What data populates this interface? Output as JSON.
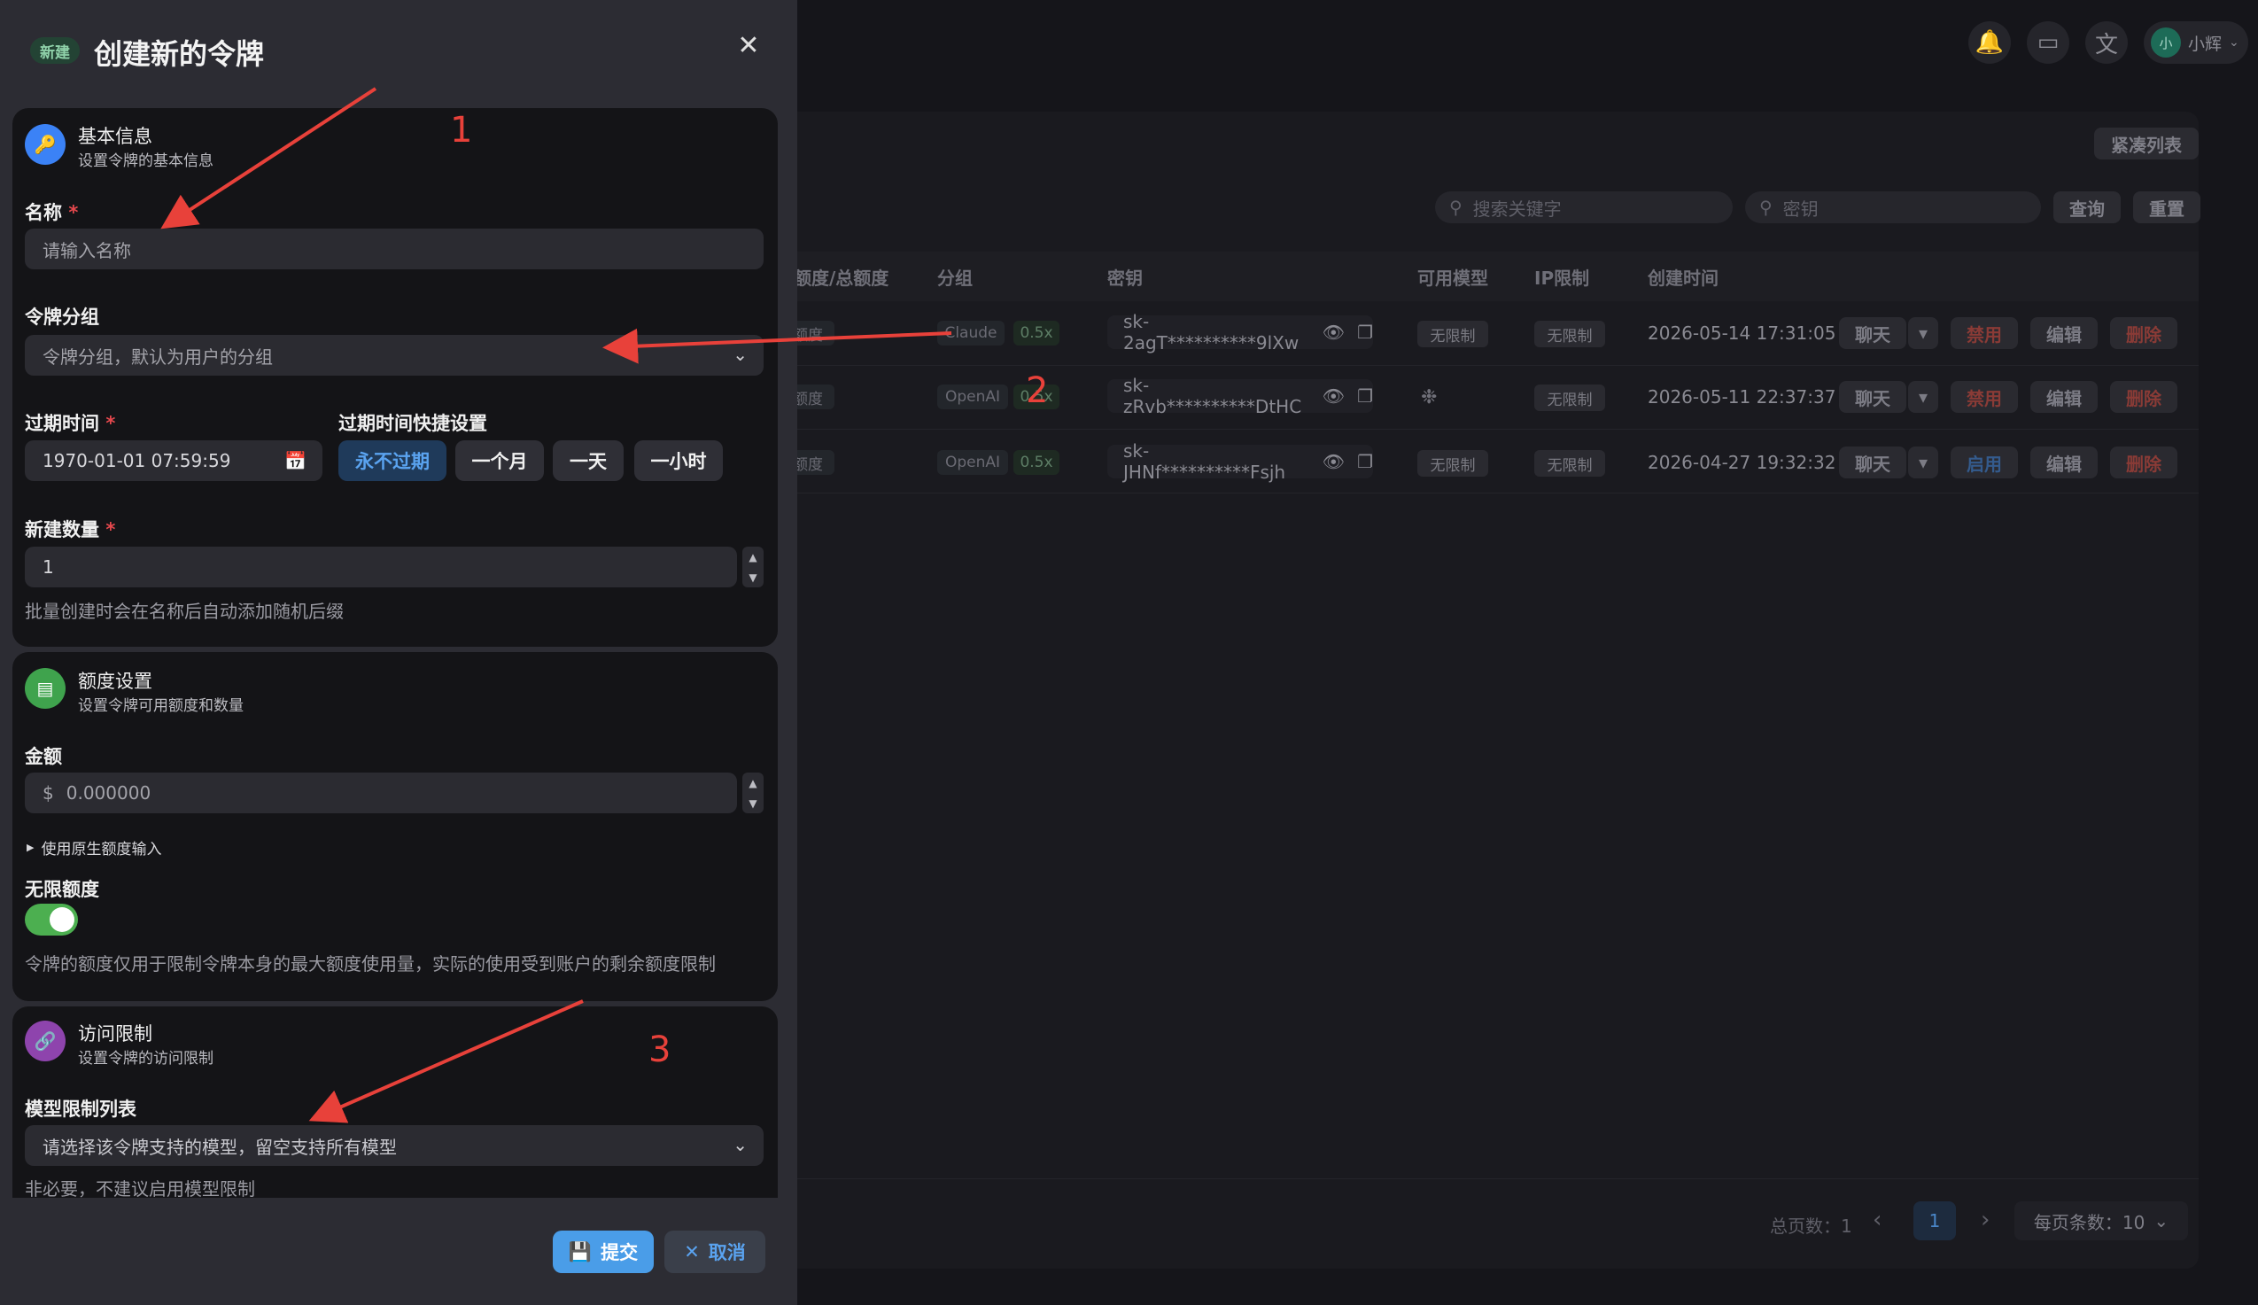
{
  "header": {
    "bell_icon": "bell-icon",
    "monitor_icon": "monitor-icon",
    "translate_icon": "translate-icon",
    "user_avatar": "小",
    "user_name": "小辉"
  },
  "list": {
    "compact_label": "紧凑列表",
    "search_placeholder": "搜索关键字",
    "key_placeholder": "密钥",
    "query_label": "查询",
    "reset_label": "重置",
    "columns": [
      "额度/总额度",
      "分组",
      "密钥",
      "可用模型",
      "IP限制",
      "创建时间"
    ],
    "rows": [
      {
        "quota": "额度",
        "group": "Claude",
        "multiplier": "0.5x",
        "key": "sk-2agT**********9lXw",
        "models": "无限制",
        "ip": "无限制",
        "created": "2026-05-14 17:31:05",
        "toggle_label": "禁用"
      },
      {
        "quota": "额度",
        "group": "OpenAI",
        "multiplier": "0.5x",
        "key": "sk-zRvb**********DtHC",
        "models": "openai-icon",
        "ip": "无限制",
        "created": "2026-05-11 22:37:37",
        "toggle_label": "禁用"
      },
      {
        "quota": "额度",
        "group": "OpenAI",
        "multiplier": "0.5x",
        "key": "sk-JHNf**********Fsjh",
        "models": "无限制",
        "ip": "无限制",
        "created": "2026-04-27 19:32:32",
        "toggle_label": "启用"
      }
    ],
    "row_actions": {
      "chat": "聊天",
      "edit": "编辑",
      "delete": "删除"
    },
    "pagination": {
      "total_label": "总页数：1",
      "current_page": "1",
      "page_size_label": "每页条数：10"
    }
  },
  "modal": {
    "badge": "新建",
    "title": "创建新的令牌",
    "basic": {
      "title": "基本信息",
      "subtitle": "设置令牌的基本信息",
      "name_label": "名称",
      "name_placeholder": "请输入名称",
      "group_label": "令牌分组",
      "group_placeholder": "令牌分组，默认为用户的分组",
      "expire_label": "过期时间",
      "expire_value": "1970-01-01 07:59:59",
      "quick_label": "过期时间快捷设置",
      "quick_options": [
        "永不过期",
        "一个月",
        "一天",
        "一小时"
      ],
      "count_label": "新建数量",
      "count_value": "1",
      "count_hint": "批量创建时会在名称后自动添加随机后缀"
    },
    "quota": {
      "title": "额度设置",
      "subtitle": "设置令牌可用额度和数量",
      "amount_label": "金额",
      "amount_prefix": "$",
      "amount_placeholder": "0.000000",
      "raw_toggle": "使用原生额度输入",
      "unlimited_label": "无限额度",
      "unlimited_on": true,
      "hint": "令牌的额度仅用于限制令牌本身的最大额度使用量，实际的使用受到账户的剩余额度限制"
    },
    "access": {
      "title": "访问限制",
      "subtitle": "设置令牌的访问限制",
      "models_label": "模型限制列表",
      "models_placeholder": "请选择该令牌支持的模型，留空支持所有模型",
      "models_hint": "非必要，不建议启用模型限制"
    },
    "submit_label": "提交",
    "cancel_label": "取消"
  },
  "annotations": [
    "1",
    "2",
    "3"
  ],
  "annotation_color": "#e8413a"
}
